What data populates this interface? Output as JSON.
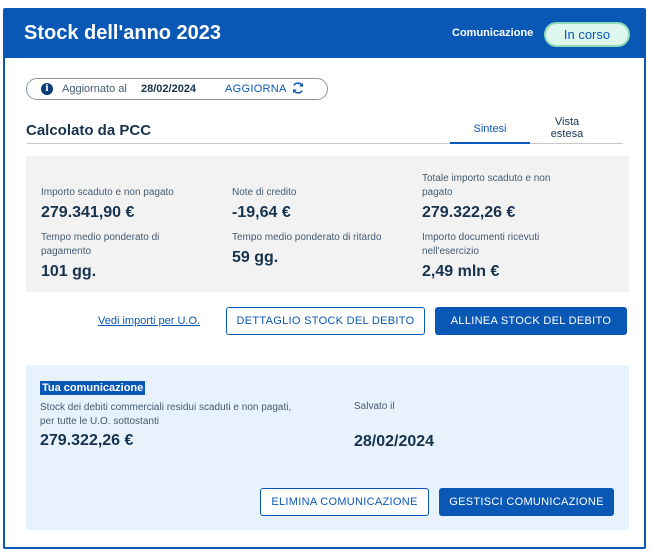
{
  "header": {
    "title": "Stock dell'anno 2023",
    "communication_label": "Comunicazione",
    "status": "In corso"
  },
  "update": {
    "label": "Aggiornato al",
    "date": "28/02/2024",
    "refresh_label": "AGGIORNA",
    "icons": {
      "info": "info-icon",
      "refresh": "refresh-icon"
    }
  },
  "section": {
    "title": "Calcolato da PCC",
    "tabs": [
      {
        "label": "Sintesi",
        "active": true
      },
      {
        "label": "Vista estesa",
        "active": false
      }
    ]
  },
  "metrics": [
    {
      "label": "Importo scaduto e non pagato",
      "value": "279.341,90 €"
    },
    {
      "label": "Note di credito",
      "value": "-19,64 €"
    },
    {
      "label": "Totale importo scaduto e non pagato",
      "value": "279.322,26 €"
    },
    {
      "label": "Tempo medio ponderato di pagamento",
      "value": "101 gg."
    },
    {
      "label": "Tempo medio ponderato di ritardo",
      "value": "59 gg."
    },
    {
      "label": "Importo documenti ricevuti nell'esercizio",
      "value": "2,49 mln €"
    }
  ],
  "actions": {
    "link_label": "Vedi importi per U.O.",
    "detail_button": "DETTAGLIO STOCK DEL DEBITO",
    "align_button": "ALLINEA STOCK DEL DEBITO"
  },
  "communication": {
    "title": "Tua comunicazione",
    "stock_label": "Stock dei debiti commerciali residui scaduti e non pagati, per tutte le U.O. sottostanti",
    "stock_value": "279.322,26 €",
    "saved_label": "Salvato il",
    "saved_value": "28/02/2024",
    "delete_button": "ELIMINA COMUNICAZIONE",
    "manage_button": "GESTISCI COMUNICAZIONE"
  },
  "colors": {
    "primary": "#0a58b5",
    "status_bg": "#dff8ed",
    "summary_bg": "#f2f2f2",
    "comm_bg": "#e7f2fc",
    "text": "#17324d"
  }
}
